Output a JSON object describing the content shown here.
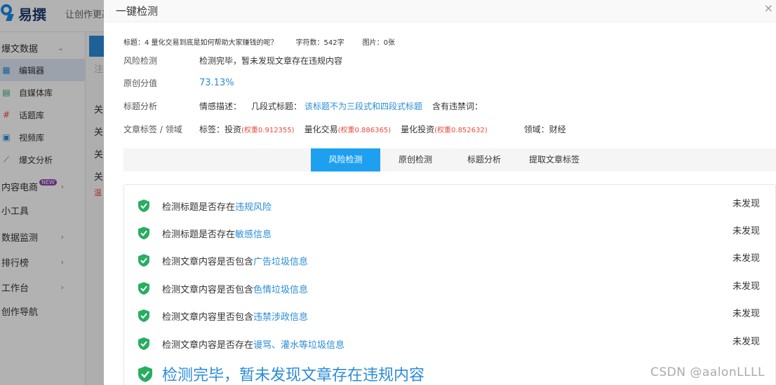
{
  "background": {
    "logo_text": "易撰",
    "slogan": "让创作更高效",
    "sidebar": {
      "section_title": "爆文数据",
      "items": [
        {
          "label": "编辑器",
          "icon": "grid-icon",
          "active": true
        },
        {
          "label": "自媒体库",
          "icon": "doc-icon"
        },
        {
          "label": "话题库",
          "icon": "hash-icon"
        },
        {
          "label": "视频库",
          "icon": "video-icon"
        },
        {
          "label": "爆文分析",
          "icon": "chart-icon"
        }
      ],
      "groups": [
        {
          "label": "内容电商",
          "badge": "NEW",
          "has_arrow": true
        },
        {
          "label": "小工具",
          "has_arrow": false
        },
        {
          "label": "数据监测",
          "has_arrow": true
        },
        {
          "label": "排行榜",
          "has_arrow": true
        },
        {
          "label": "工作台",
          "has_arrow": true
        },
        {
          "label": "创作导航",
          "has_arrow": false
        }
      ]
    },
    "mid_chars": [
      "注",
      "关",
      "关",
      "关",
      "关",
      "温"
    ]
  },
  "modal": {
    "title": "一键检测",
    "meta": {
      "title_label": "标题：4 量化交易到底是如何帮助大家赚钱的呢？",
      "char_count": "字符数：542字",
      "image_count": "图片：0张"
    },
    "risk": {
      "label": "风险检测",
      "value": "检测完毕，暂未发现文章存在违规内容"
    },
    "originality": {
      "label": "原创分值",
      "value": "73.13%"
    },
    "title_analysis": {
      "label": "标题分析",
      "emotion": "情感描述：",
      "pattern_label": "几段式标题：",
      "pattern_value": "该标题不为三段式和四段式标题",
      "banned": "含有违禁词："
    },
    "tags": {
      "label": "文章标签 / 领域",
      "prefix": "标签：",
      "items": [
        {
          "name": "投资",
          "weight": "(权重0.912355)"
        },
        {
          "name": "量化交易",
          "weight": "(权重0.886365)"
        },
        {
          "name": "量化投资",
          "weight": "(权重0.852632)"
        }
      ],
      "domain": "领域：财经"
    },
    "tabs": [
      "风险检测",
      "原创检测",
      "标题分析",
      "提取文章标签"
    ],
    "checks": [
      {
        "prefix": "检测标题是否存在",
        "highlight": "违规风险",
        "status": "未发现"
      },
      {
        "prefix": "检测标题是否存在",
        "highlight": "敏感信息",
        "status": "未发现"
      },
      {
        "prefix": "检测文章内容是否包含",
        "highlight": "广告垃圾信息",
        "status": "未发现"
      },
      {
        "prefix": "检测文章内容是否包含",
        "highlight": "色情垃圾信息",
        "status": "未发现"
      },
      {
        "prefix": "检测文章内容里否包含",
        "highlight": "违禁涉政信息",
        "status": "未发现"
      },
      {
        "prefix": "检测文章内容是否存在",
        "highlight": "谩骂、灌水等垃圾信息",
        "status": "未发现"
      }
    ],
    "final_text": "检测完毕，暂未发现文章存在违规内容"
  },
  "watermark": "CSDN @aalonLLLL",
  "colors": {
    "accent": "#2a8cd8",
    "tab_active": "#1ea0f0",
    "shield": "#27ae60",
    "weight_red": "#e74c3c"
  }
}
